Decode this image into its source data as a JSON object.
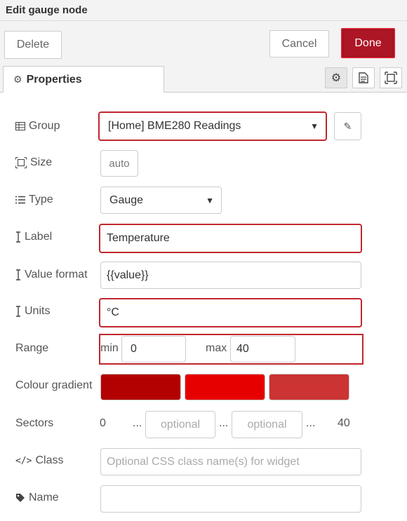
{
  "window": {
    "title": "Edit gauge node"
  },
  "toolbar": {
    "delete_label": "Delete",
    "cancel_label": "Cancel",
    "done_label": "Done"
  },
  "tabs": {
    "properties_label": "Properties"
  },
  "form": {
    "group": {
      "label": "Group",
      "value": "[Home] BME280 Readings"
    },
    "size": {
      "label": "Size",
      "value": "auto"
    },
    "type": {
      "label": "Type",
      "value": "Gauge"
    },
    "label": {
      "label": "Label",
      "value": "Temperature"
    },
    "value_format": {
      "label": "Value format",
      "value": "{{value}}"
    },
    "units": {
      "label": "Units",
      "value": "°C"
    },
    "range": {
      "label": "Range",
      "min_label": "min",
      "min_value": "0",
      "max_label": "max",
      "max_value": "40"
    },
    "colour_gradient": {
      "label": "Colour gradient",
      "colors": [
        "#b30000",
        "#e60000",
        "#cc3333"
      ]
    },
    "sectors": {
      "label": "Sectors",
      "start": "0",
      "dots": "...",
      "placeholder1": "optional",
      "placeholder2": "optional",
      "end": "40"
    },
    "class": {
      "label": "Class",
      "placeholder": "Optional CSS class name(s) for widget"
    },
    "name": {
      "label": "Name",
      "value": ""
    }
  },
  "icons": {
    "group": "table-icon",
    "size": "resize-icon",
    "type": "list-icon",
    "label": "text-cursor-icon",
    "class": "code-icon",
    "name": "tag-icon"
  }
}
